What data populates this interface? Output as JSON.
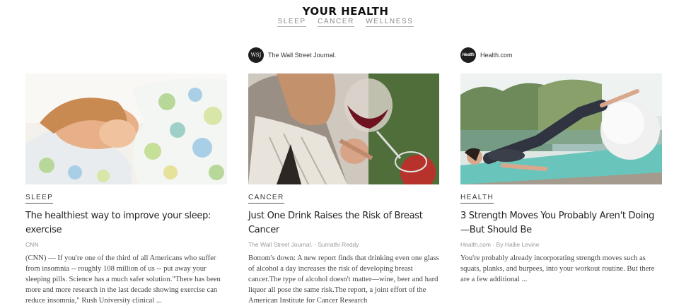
{
  "section": {
    "title": "YOUR HEALTH",
    "links": [
      "SLEEP",
      "CANCER",
      "WELLNESS"
    ]
  },
  "cards": [
    {
      "publisher": "",
      "category": "SLEEP",
      "headline": "The healthiest way to improve your sleep: exercise",
      "byline": "CNN",
      "excerpt": "(CNN) — If you're one of the third of all Americans who suffer from insomnia -- roughly 108 million of us -- put away your sleeping pills. Science has a much safer solution.\"There has been more and more research in the last decade showing exercise can reduce insomnia,\" Rush University clinical ..."
    },
    {
      "publisher": "The Wall Street Journal.",
      "publisher_logo": "WSJ",
      "category": "CANCER",
      "headline": "Just One Drink Raises the Risk of Breast Cancer",
      "byline": "The Wall Street Journal. · Sumathi Reddy",
      "excerpt": "Bottom's down: A new report finds that drinking even one glass of alcohol a day increases the risk of developing breast cancer.The type of alcohol doesn't matter—wine, beer and hard liquor all pose the same risk.The report, a joint effort of the American Institute for Cancer Research"
    },
    {
      "publisher": "Health.com",
      "publisher_logo": "Health",
      "category": "HEALTH",
      "headline": "3 Strength Moves You Probably Aren't Doing—But Should Be",
      "byline": "Health.com · By Hallie Levine",
      "excerpt": "You're probably already incorporating strength moves such as squats, planks, and burpees, into your workout routine. But there are a few additional ..."
    }
  ]
}
